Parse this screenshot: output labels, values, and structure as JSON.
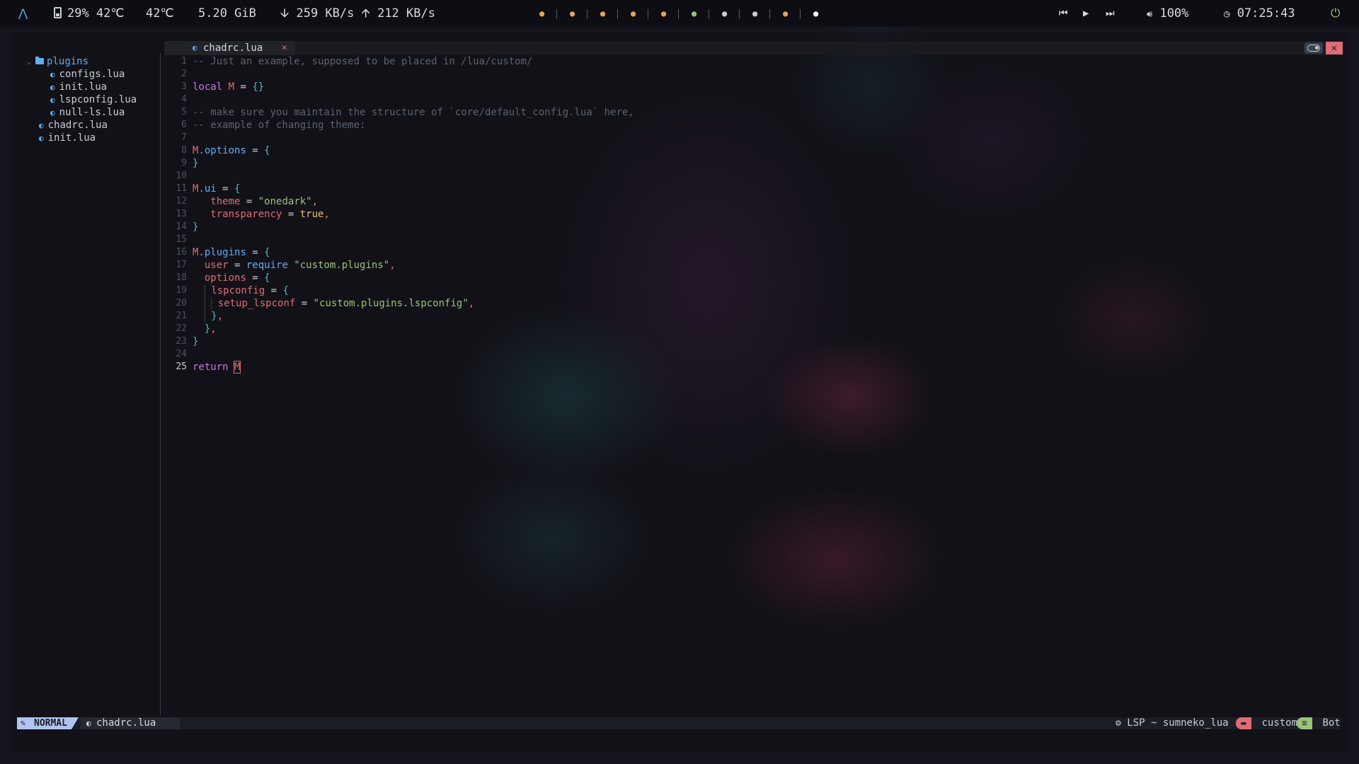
{
  "topbar": {
    "logo_icon": "arch-icon",
    "battery": "29% 42℃",
    "temp": "42℃",
    "memory": "5.20 GiB",
    "net_down": "259 KB/s",
    "net_up": "212 KB/s",
    "workspaces": [
      {
        "color": "#e5a35b"
      },
      {
        "color": "#e5a35b"
      },
      {
        "color": "#e5a35b"
      },
      {
        "color": "#e5a35b"
      },
      {
        "color": "#e5a35b"
      },
      {
        "color": "#98c379"
      },
      {
        "color": "#c8ccd4"
      },
      {
        "color": "#c8ccd4"
      },
      {
        "color": "#e5a35b"
      },
      {
        "color": "#ffffff"
      }
    ],
    "volume": "100%",
    "clock": "07:25:43"
  },
  "tree": {
    "folder": "plugins",
    "folder_files": [
      "configs.lua",
      "init.lua",
      "lspconfig.lua",
      "null-ls.lua"
    ],
    "root_files": [
      "chadrc.lua",
      "init.lua"
    ]
  },
  "tabline": {
    "active_tab": "chadrc.lua",
    "close_glyph": "✕",
    "window_close_glyph": "✕"
  },
  "editor": {
    "line_numbers": [
      "1",
      "2",
      "3",
      "4",
      "5",
      "6",
      "7",
      "8",
      "9",
      "10",
      "11",
      "12",
      "13",
      "14",
      "15",
      "16",
      "17",
      "18",
      "19",
      "20",
      "21",
      "22",
      "23",
      "24",
      "25"
    ],
    "lines": {
      "l1": "-- Just an example, supposed to be placed in /lua/custom/",
      "l3_kw": "local",
      "l3_name": "M",
      "l3_rest": " = ",
      "l3_tbl": "{}",
      "l5": "-- make sure you maintain the structure of `core/default_config.lua` here,",
      "l6": "-- example of changing theme:",
      "l8_obj": "M",
      "l8_field": ".options",
      "l8_rest": " = ",
      "l8_br": "{",
      "l9_br": "}",
      "l11_obj": "M",
      "l11_field": ".ui",
      "l11_rest": " = ",
      "l11_br": "{",
      "l12_key": "theme",
      "l12_eq": " = ",
      "l12_str": "\"onedark\"",
      "l12_c": ",",
      "l13_key": "transparency",
      "l13_eq": " = ",
      "l13_val": "true",
      "l13_c": ",",
      "l14_br": "}",
      "l16_obj": "M",
      "l16_field": ".plugins",
      "l16_rest": " = ",
      "l16_br": "{",
      "l17_key": "user",
      "l17_eq": " = ",
      "l17_fn": "require",
      "l17_str": " \"custom.plugins\"",
      "l17_c": ",",
      "l18_key": "options",
      "l18_eq": " = ",
      "l18_br": "{",
      "l19_key": "lspconfig",
      "l19_eq": " = ",
      "l19_br": "{",
      "l20_key": "setup_lspconf",
      "l20_eq": " = ",
      "l20_str": "\"custom.plugins.lspconfig\"",
      "l20_c": ",",
      "l21_br": "}",
      "l21_c": ",",
      "l22_br": "}",
      "l22_c": ",",
      "l23_br": "}",
      "l25_kw": "return",
      "l25_cursor": "M"
    }
  },
  "statusline": {
    "mode": "NORMAL",
    "file": "chadrc.lua",
    "lsp": "LSP ~ sumneko_lua",
    "cwd": "custom",
    "position": "Bot"
  }
}
